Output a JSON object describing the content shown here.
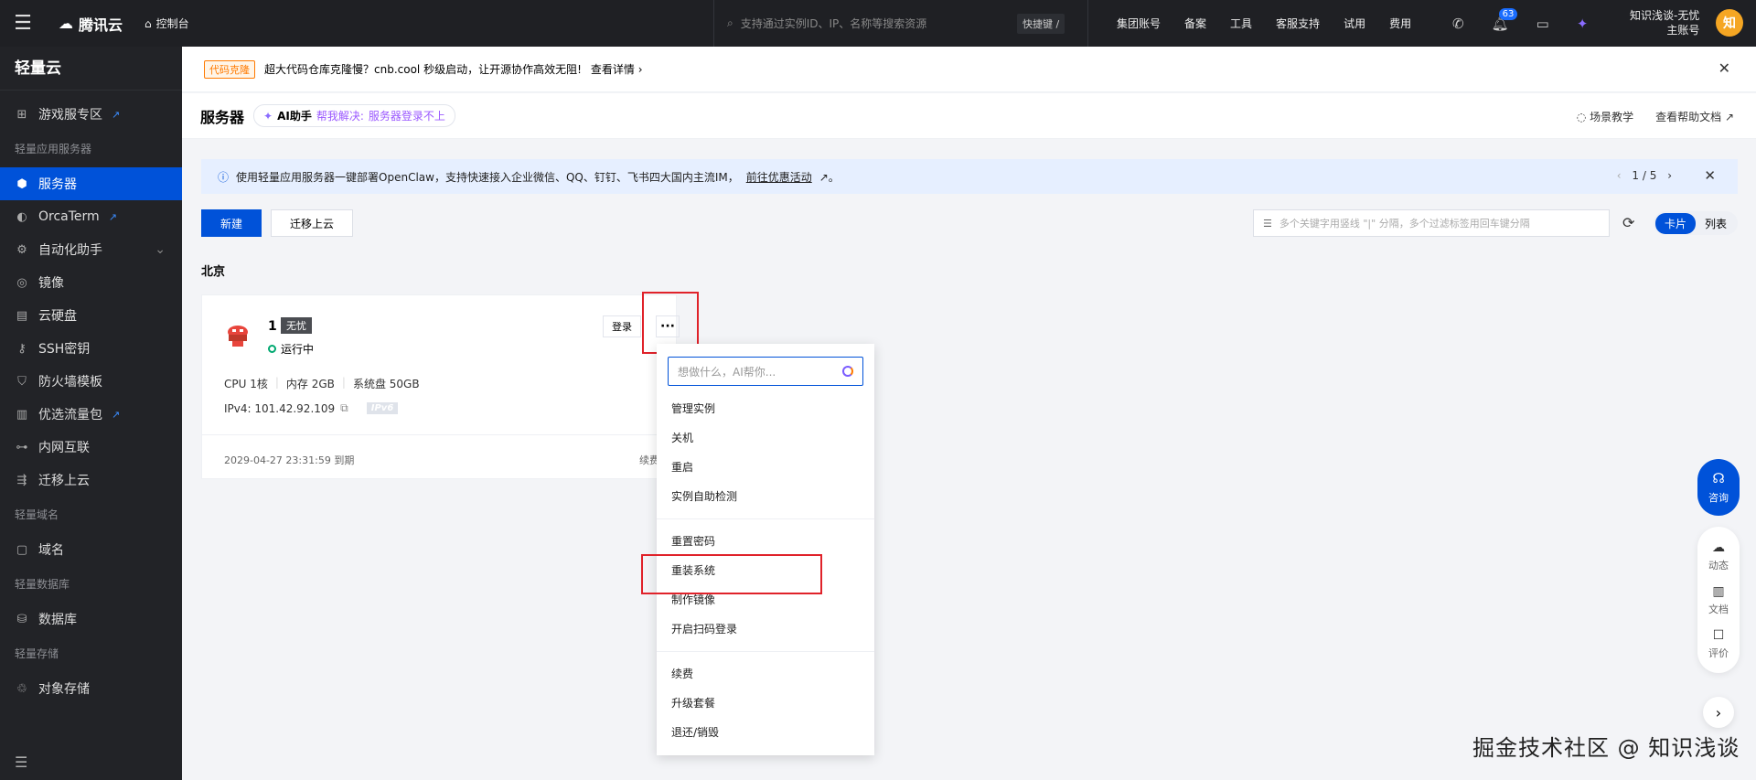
{
  "topbar": {
    "brand": "腾讯云",
    "console": "控制台",
    "search_placeholder": "支持通过实例ID、IP、名称等搜索资源",
    "shortcut": "快捷键 /",
    "links": [
      "集团账号",
      "备案",
      "工具",
      "客服支持",
      "试用",
      "费用"
    ],
    "notification_count": "63",
    "user_name": "知识浅谈-无忧",
    "user_role": "主账号",
    "avatar_text": "知"
  },
  "sidebar": {
    "title": "轻量云",
    "items": [
      {
        "label": "游戏服专区",
        "icon": "gamepad-icon",
        "external": true
      },
      {
        "group": "轻量应用服务器"
      },
      {
        "label": "服务器",
        "icon": "server-cube-icon",
        "active": true
      },
      {
        "label": "OrcaTerm",
        "icon": "terminal-icon",
        "external": true
      },
      {
        "label": "自动化助手",
        "icon": "automation-icon",
        "expand": true
      },
      {
        "label": "镜像",
        "icon": "image-disc-icon"
      },
      {
        "label": "云硬盘",
        "icon": "disk-icon"
      },
      {
        "label": "SSH密钥",
        "icon": "key-icon"
      },
      {
        "label": "防火墙模板",
        "icon": "shield-icon"
      },
      {
        "label": "优选流量包",
        "icon": "traffic-chart-icon",
        "external": true
      },
      {
        "label": "内网互联",
        "icon": "network-icon"
      },
      {
        "label": "迁移上云",
        "icon": "migrate-icon"
      },
      {
        "group": "轻量域名"
      },
      {
        "label": "域名",
        "icon": "domain-icon"
      },
      {
        "group": "轻量数据库"
      },
      {
        "label": "数据库",
        "icon": "database-icon"
      },
      {
        "group": "轻量存储"
      },
      {
        "label": "对象存储",
        "icon": "storage-icon"
      }
    ]
  },
  "banner": {
    "tag": "代码克隆",
    "text": "超大代码仓库克隆慢？cnb.cool 秒级启动，让开源协作高效无阻!",
    "link": "查看详情"
  },
  "page_header": {
    "title": "服务器",
    "ai_label": "AI助手",
    "ai_hint_prefix": "帮我解决:",
    "ai_hint": "服务器登录不上",
    "scene_tutorial": "场景教学",
    "help_doc": "查看帮助文档"
  },
  "notice": {
    "text": "使用轻量应用服务器一键部署OpenClaw，支持快速接入企业微信、QQ、钉钉、飞书四大国内主流IM，",
    "link": "前往优惠活动",
    "page": "1 / 5"
  },
  "toolbar": {
    "new": "新建",
    "migrate": "迁移上云",
    "filter_placeholder": "多个关键字用竖线 \"|\" 分隔，多个过滤标签用回车键分隔",
    "view_card": "卡片",
    "view_list": "列表"
  },
  "region": "北京",
  "instance": {
    "name": "1",
    "tag": "无忧",
    "status": "运行中",
    "cpu": "CPU 1核",
    "memory": "内存 2GB",
    "disk": "系统盘 50GB",
    "ipv4": "IPv4: 101.42.92.109",
    "ipv6": "IPv6",
    "expire": "2029-04-27 23:31:59 到期",
    "renew": "续费",
    "login": "登录",
    "more": "···"
  },
  "dropdown": {
    "placeholder": "想做什么，AI帮你...",
    "group1": [
      "管理实例",
      "关机",
      "重启",
      "实例自助检测"
    ],
    "group2": [
      "重置密码",
      "重装系统",
      "制作镜像",
      "开启扫码登录"
    ],
    "group3": [
      "续费",
      "升级套餐",
      "退还/销毁"
    ]
  },
  "float": {
    "consult": "咨询",
    "dynamic": "动态",
    "doc": "文档",
    "review": "评价"
  },
  "watermark": "掘金技术社区 @ 知识浅谈",
  "colors": {
    "primary": "#0052d9",
    "highlight": "#e0222a",
    "topbar": "#1f2024",
    "sidebar": "#222327"
  }
}
